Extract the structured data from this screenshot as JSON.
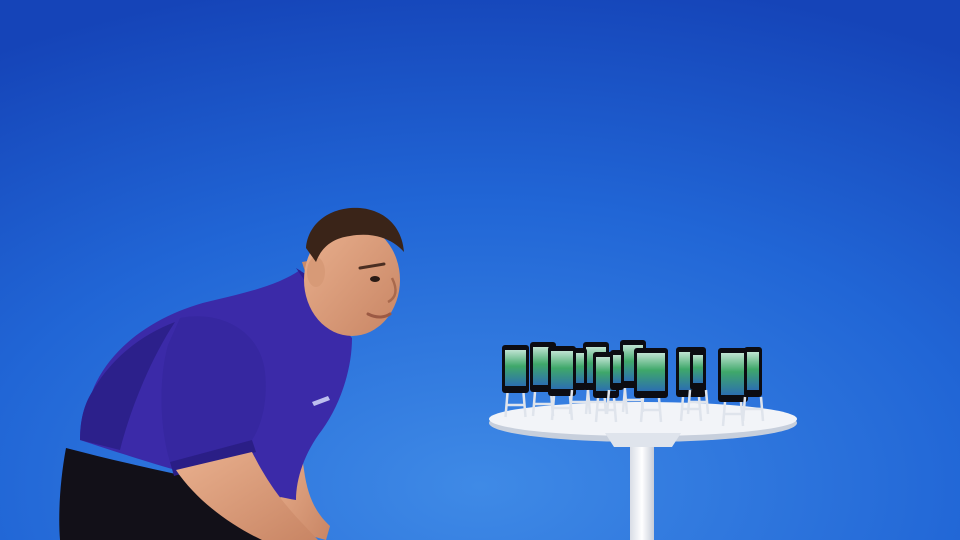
{
  "scene": {
    "kind": "photograph",
    "backdrop_colors": {
      "top": "#1544b8",
      "middle": "#2166d6",
      "bottom": "#3f8ae6"
    },
    "shirt_color": "#3b2aa8",
    "shirt_shadow": "#2a1e86",
    "table_color": "#f2f4f8",
    "phone_count": 13,
    "phone_screen_color": "#3fa86a"
  }
}
